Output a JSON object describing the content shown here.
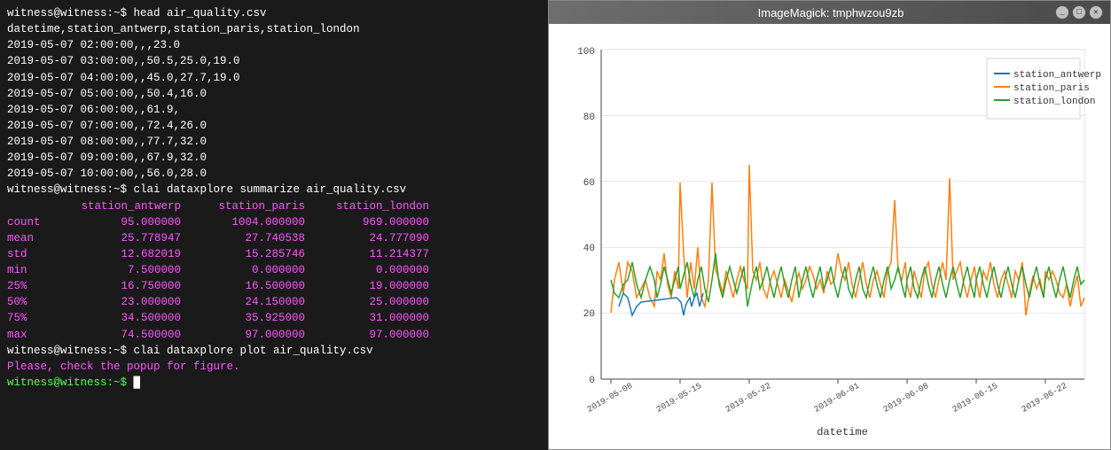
{
  "terminal": {
    "lines": [
      {
        "type": "cmd",
        "text": "witness@witness:~$ head air_quality.csv"
      },
      {
        "type": "output",
        "text": "datetime,station_antwerp,station_paris,station_london"
      },
      {
        "type": "output",
        "text": "2019-05-07 02:00:00,,,23.0"
      },
      {
        "type": "output",
        "text": "2019-05-07 03:00:00,,50.5,25.0,19.0"
      },
      {
        "type": "output",
        "text": "2019-05-07 04:00:00,,45.0,27.7,19.0"
      },
      {
        "type": "output",
        "text": "2019-05-07 05:00:00,,50.4,16.0"
      },
      {
        "type": "output",
        "text": "2019-05-07 06:00:00,,61.9,"
      },
      {
        "type": "output",
        "text": "2019-05-07 07:00:00,,72.4,26.0"
      },
      {
        "type": "output",
        "text": "2019-05-07 08:00:00,,77.7,32.0"
      },
      {
        "type": "output",
        "text": "2019-05-07 09:00:00,,67.9,32.0"
      },
      {
        "type": "output",
        "text": "2019-05-07 10:00:00,,56.0,28.0"
      },
      {
        "type": "cmd",
        "text": "witness@witness:~$ clai dataxplore summarize air_quality.csv"
      }
    ],
    "stats": {
      "header": [
        "",
        "station_antwerp",
        "station_paris",
        "station_london"
      ],
      "rows": [
        [
          "count",
          "95.000000",
          "1004.000000",
          "969.000000"
        ],
        [
          "mean",
          "25.778947",
          "27.740538",
          "24.777090"
        ],
        [
          "std",
          "12.682019",
          "15.285746",
          "11.214377"
        ],
        [
          "min",
          "7.500000",
          "0.000000",
          "0.000000"
        ],
        [
          "25%",
          "16.750000",
          "16.500000",
          "19.000000"
        ],
        [
          "50%",
          "23.000000",
          "24.150000",
          "25.000000"
        ],
        [
          "75%",
          "34.500000",
          "35.925000",
          "31.000000"
        ],
        [
          "max",
          "74.500000",
          "97.000000",
          "97.000000"
        ]
      ]
    },
    "bottom_lines": [
      {
        "type": "cmd",
        "text": "witness@witness:~$ clai dataxplore plot air_quality.csv"
      },
      {
        "type": "magenta",
        "text": "Please, check the popup for figure."
      },
      {
        "type": "prompt",
        "text": "witness@witness:~$ "
      }
    ]
  },
  "imagemagick": {
    "title": "ImageMagick: tmphwzou9zb",
    "buttons": [
      "_",
      "□",
      "✕"
    ],
    "legend": [
      {
        "color": "#1f77b4",
        "label": "station_antwerp"
      },
      {
        "color": "#ff7f0e",
        "label": "station_paris"
      },
      {
        "color": "#2ca02c",
        "label": "station_london"
      }
    ],
    "chart": {
      "xaxis_label": "datetime",
      "xaxis_ticks": [
        "2019-05-08",
        "2019-05-15",
        "2019-05-22",
        "2019-06-01",
        "2019-06-08",
        "2019-06-15",
        "2019-06-22"
      ],
      "yaxis_ticks": [
        "0",
        "20",
        "40",
        "60",
        "80",
        "100"
      ],
      "ymax": 100
    }
  }
}
